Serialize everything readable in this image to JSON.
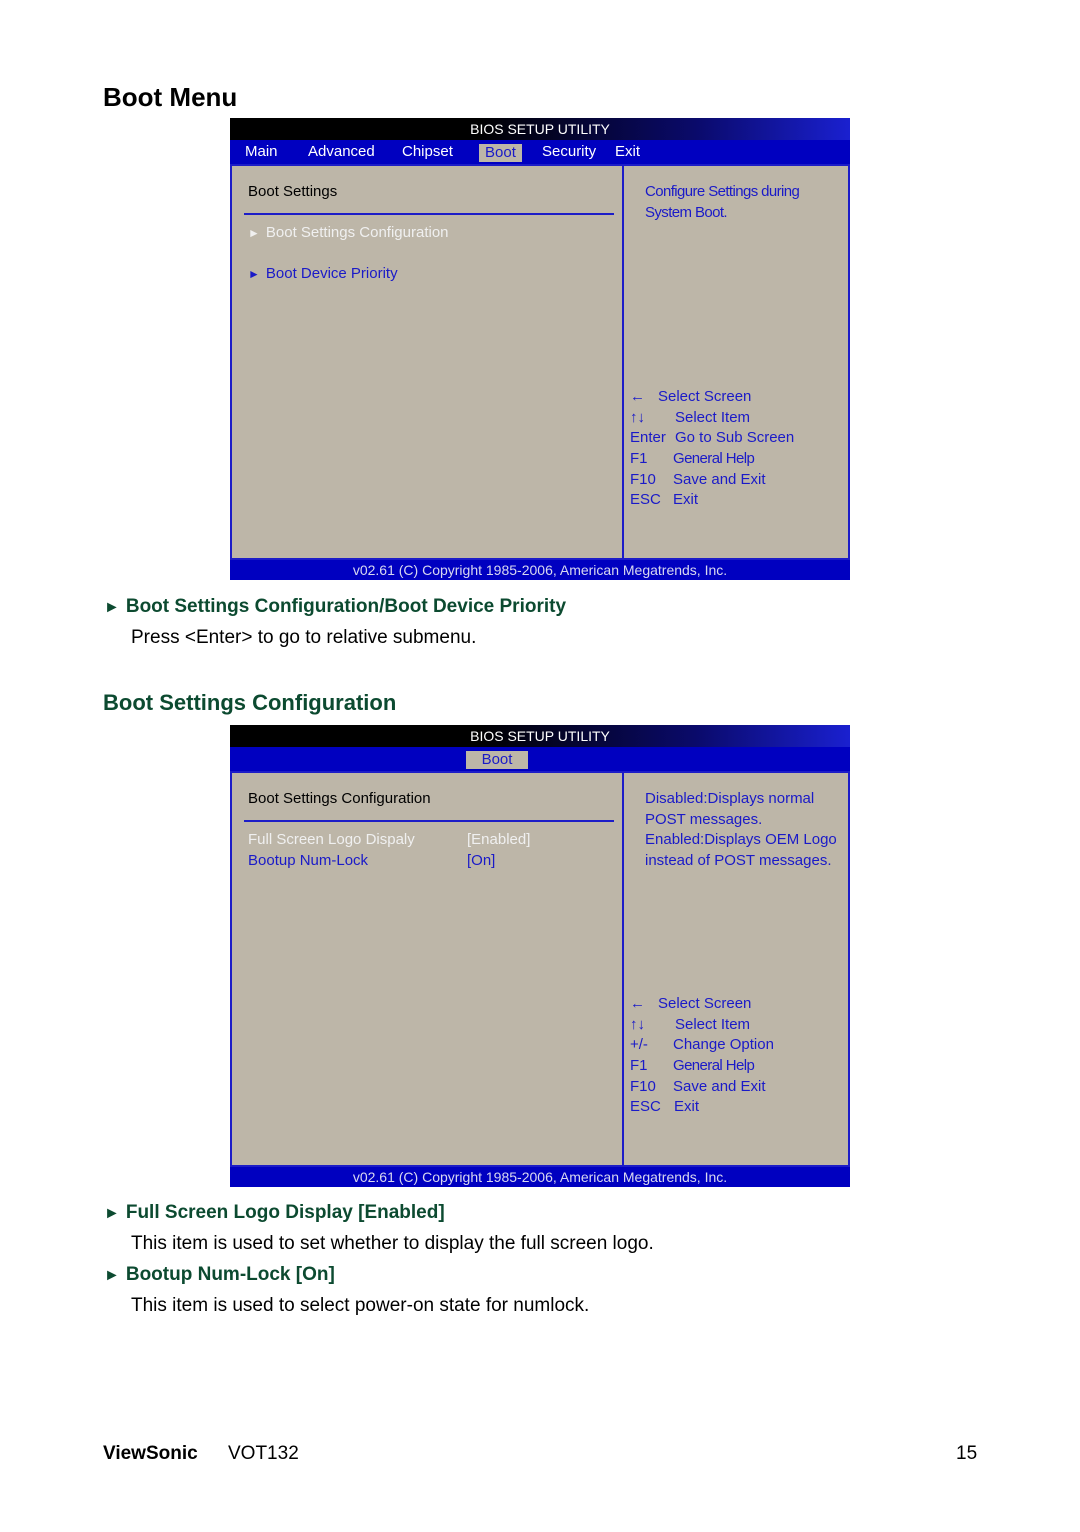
{
  "page": {
    "title": "Boot Menu",
    "brand": "ViewSonic",
    "model": "VOT132",
    "page_number": "15"
  },
  "bios1": {
    "title": "BIOS SETUP UTILITY",
    "tabs": [
      {
        "label": "Main",
        "active": false
      },
      {
        "label": "Advanced",
        "active": false
      },
      {
        "label": "Chipset",
        "active": false
      },
      {
        "label": "Boot",
        "active": true
      },
      {
        "label": "Security",
        "active": false
      },
      {
        "label": "Exit",
        "active": false
      }
    ],
    "section": "Boot Settings",
    "items": [
      {
        "label": "Boot Settings Configuration",
        "selected": true,
        "icon": "right-triangle-icon"
      },
      {
        "label": "Boot Device Priority",
        "selected": false,
        "icon": "right-triangle-icon"
      }
    ],
    "help": "Configure Settings during\nSystem Boot.",
    "keys": [
      {
        "key": "←",
        "desc": "Select Screen"
      },
      {
        "key": "↑↓",
        "desc": "Select Item"
      },
      {
        "key": "Enter",
        "desc": "Go to Sub Screen"
      },
      {
        "key": "F1",
        "desc": "General Help"
      },
      {
        "key": "F10",
        "desc": "Save and Exit"
      },
      {
        "key": "ESC",
        "desc": "Exit"
      }
    ],
    "copyright": "v02.61 (C) Copyright 1985-2006, American Megatrends, Inc."
  },
  "section1": {
    "heading": "Boot Settings Configuration/Boot Device Priority",
    "text": "Press <Enter> to go to relative submenu."
  },
  "section2": {
    "title": "Boot Settings Configuration"
  },
  "bios2": {
    "title": "BIOS SETUP UTILITY",
    "tabs": [
      {
        "label": "Boot",
        "active": true
      }
    ],
    "section": "Boot Settings Configuration",
    "options": [
      {
        "label": "Full Screen Logo Dispaly",
        "value": "[Enabled]",
        "selected": true
      },
      {
        "label": "Bootup Num-Lock",
        "value": "[On]",
        "selected": false
      }
    ],
    "help": "Disabled:Displays normal\nPOST messages.\nEnabled:Displays OEM Logo\ninstead of POST messages.",
    "keys": [
      {
        "key": "←",
        "desc": "Select Screen"
      },
      {
        "key": "↑↓",
        "desc": "Select Item"
      },
      {
        "key": "+/-",
        "desc": "Change Option"
      },
      {
        "key": "F1",
        "desc": "General Help"
      },
      {
        "key": "F10",
        "desc": "Save and Exit"
      },
      {
        "key": "ESC",
        "desc": "Exit"
      }
    ],
    "copyright": "v02.61 (C) Copyright 1985-2006, American Megatrends, Inc."
  },
  "items_desc": [
    {
      "heading": "Full Screen Logo Display [Enabled]",
      "text": "This item is used to set whether to display the full screen logo."
    },
    {
      "heading": "Bootup Num-Lock [On]",
      "text": "This item is used to select power-on state for numlock."
    }
  ],
  "colors": {
    "bios_blue": "#0000c0",
    "bios_panel": "#bdb6a8",
    "bios_text": "#1a1ac8",
    "heading_green": "#0c4a30"
  }
}
